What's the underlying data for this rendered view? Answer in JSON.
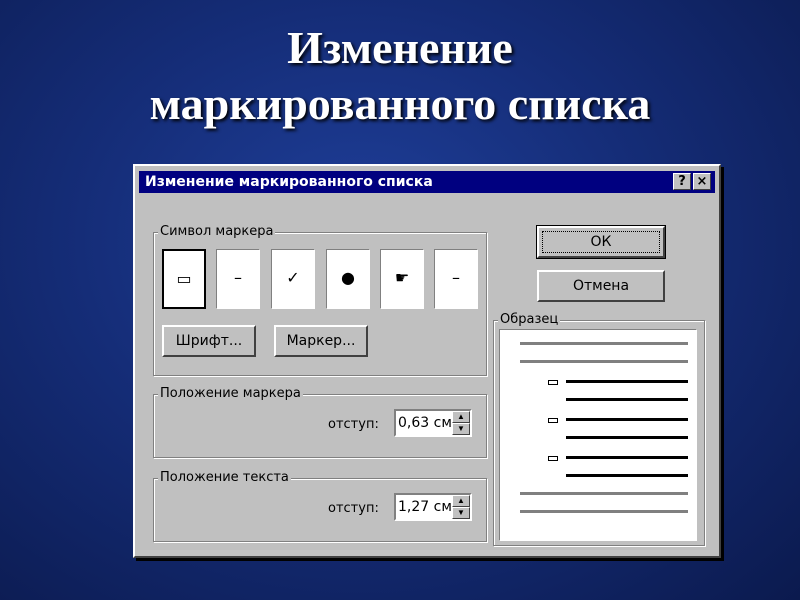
{
  "slide": {
    "title_line1": "Изменение",
    "title_line2": "маркированного списка"
  },
  "dialog": {
    "title": "Изменение маркированного списка",
    "help_label": "?",
    "close_label": "×",
    "bullet_group": {
      "label": "Символ маркера",
      "bullets": [
        "▭",
        "–",
        "✓",
        "●",
        "☛",
        "–"
      ]
    },
    "font_button": "Шрифт...",
    "marker_button": "Маркер...",
    "ok_button": "ОК",
    "cancel_button": "Отмена",
    "marker_position": {
      "label": "Положение маркера",
      "indent_label": "отступ:",
      "value": "0,63 см"
    },
    "text_position": {
      "label": "Положение текста",
      "indent_label": "отступ:",
      "value": "1,27 см"
    },
    "preview": {
      "label": "Образец"
    },
    "spin_up": "▲",
    "spin_down": "▼"
  }
}
